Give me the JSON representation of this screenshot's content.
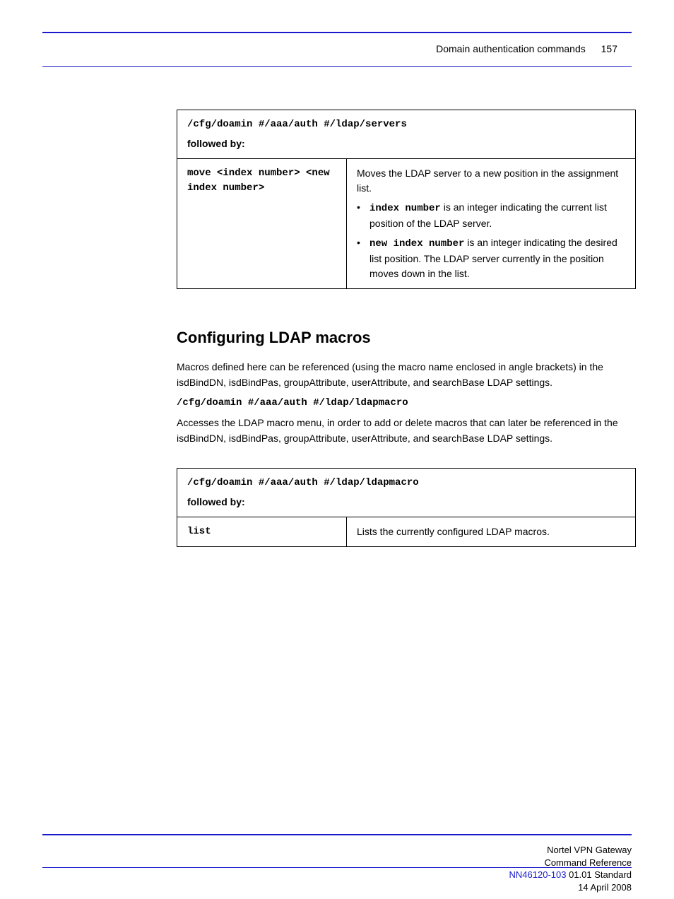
{
  "header": {
    "section_label": "Domain authentication commands",
    "page_number": "157"
  },
  "table1": {
    "path": "/cfg/doamin #/aaa/auth #/ldap/servers",
    "caption": "followed by:",
    "r1": {
      "left_pre": "move <index number> <new",
      "left_post": "index number>",
      "desc_intro": "Moves the LDAP server to a new position in the assignment list.",
      "b1_label": "index number",
      "b1_text": " is an integer indicating the current list position of the LDAP server.",
      "b2_label": "new index number",
      "b2_text": " is an integer indicating the desired list position. The LDAP server currently in the position moves down in the list."
    }
  },
  "section": {
    "title": "Configuring LDAP macros",
    "intro": "Macros defined here can be referenced (using the macro name enclosed in angle brackets) in the isdBindDN, isdBindPas, groupAttribute, userAttribute, and searchBase LDAP settings.",
    "cmd": "/cfg/doamin #/aaa/auth #/ldap/ldapmacro",
    "desc": "Accesses the LDAP macro menu, in order to add or delete macros that can later be referenced in the isdBindDN, isdBindPas, groupAttribute, userAttribute, and searchBase LDAP settings."
  },
  "table2": {
    "path": "/cfg/doamin #/aaa/auth #/ldap/ldapmacro",
    "caption": "followed by:",
    "r1": {
      "left": "list",
      "right": "Lists the currently configured LDAP macros."
    }
  },
  "footer": {
    "line1": "Nortel VPN Gateway",
    "line2": "Command Reference",
    "line3_prefix": "NN46120-103 ",
    "line3_rest": "01.01 Standard",
    "line4": "14 April 2008"
  }
}
